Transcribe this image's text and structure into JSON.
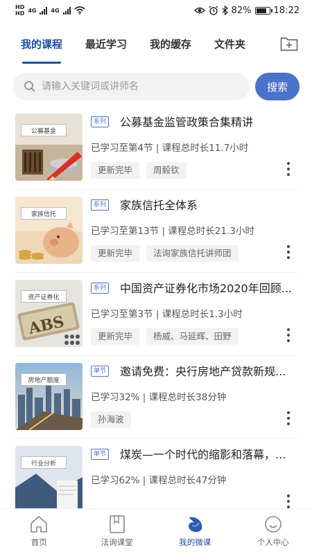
{
  "status_bar": {
    "sim1": "HD",
    "sim2": "HD",
    "network1": "4G",
    "network2": "4G",
    "battery_percent": "82%",
    "battery_level": 0.82,
    "time": "18:22",
    "icons": [
      "eye-icon",
      "alarm-icon",
      "bluetooth-icon",
      "wifi-icon"
    ]
  },
  "tabs": [
    {
      "label": "我的课程",
      "active": true
    },
    {
      "label": "最近学习",
      "active": false
    },
    {
      "label": "我的缓存",
      "active": false
    },
    {
      "label": "文件夹",
      "active": false
    }
  ],
  "search": {
    "placeholder": "请输入关键词或讲师名",
    "button_label": "搜索"
  },
  "courses": [
    {
      "thumb_label": "公募基金",
      "type": "系列",
      "title": "公募基金监管政策合集精讲",
      "progress": "已学习至第4节 | 课程总时长11.7小时",
      "chips": [
        "更新完毕",
        "周毅钦"
      ]
    },
    {
      "thumb_label": "家族信托",
      "type": "系列",
      "title": "家族信托全体系",
      "progress": "已学习至第13节 | 课程总时长21.3小时",
      "chips": [
        "更新完毕",
        "法询家族信托讲师团"
      ]
    },
    {
      "thumb_label": "资产证券化",
      "type": "系列",
      "title": "中国资产证券化市场2020年回顾...",
      "progress": "已学习至第3节 | 课程总时长1.3小时",
      "chips": [
        "更新完毕",
        "杨威、马延辉、田野"
      ]
    },
    {
      "thumb_label": "房地产额度",
      "type": "单节",
      "title": "邀请免费：央行房地产贷款新规...",
      "progress": "已学习32% | 课程总时长38分钟",
      "chips": [
        "孙海波"
      ]
    },
    {
      "thumb_label": "行业分析",
      "type": "单节",
      "title": "煤炭—一个时代的缩影和落幕，...",
      "progress": "已学习62% | 课程总时长47分钟",
      "chips": []
    }
  ],
  "bottom_nav": [
    {
      "label": "首页",
      "icon": "home-icon",
      "active": false
    },
    {
      "label": "法询课堂",
      "icon": "book-icon",
      "active": false
    },
    {
      "label": "我的微课",
      "icon": "microcourse-icon",
      "active": true
    },
    {
      "label": "个人中心",
      "icon": "profile-icon",
      "active": false
    }
  ],
  "colors": {
    "accent": "#1e4fa0",
    "button": "#4a72c9",
    "chip_bg": "#f2f2f2"
  }
}
